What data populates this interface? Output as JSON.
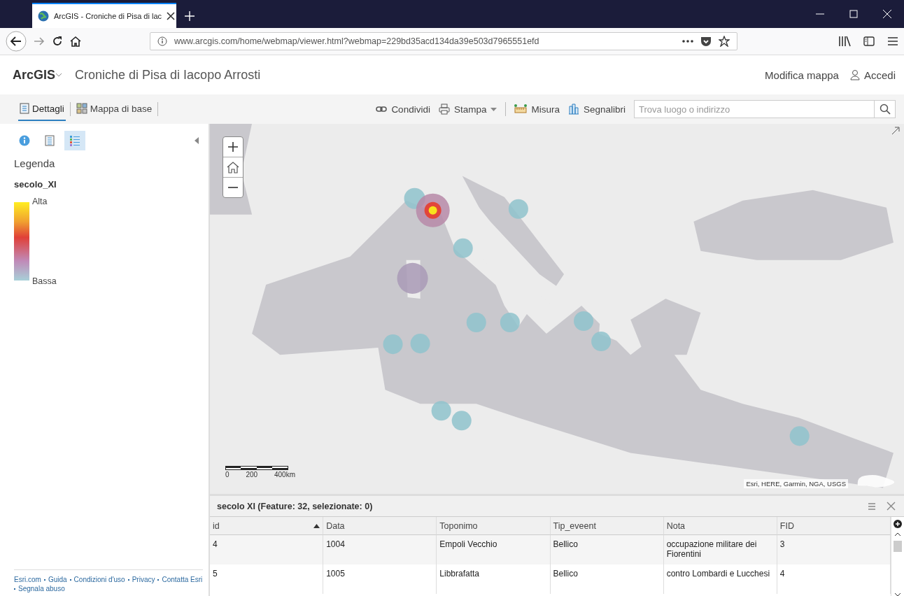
{
  "browser": {
    "tab": {
      "title": "ArcGIS - Croniche di Pisa di lac"
    },
    "url": "www.arcgis.com/home/webmap/viewer.html?webmap=229bd35acd134da39e503d7965551efd"
  },
  "header": {
    "app": "ArcGIS",
    "title": "Croniche di Pisa di Iacopo Arrosti",
    "actions": [
      {
        "label": "Modifica mappa",
        "kind": "text"
      },
      {
        "label": "Accedi",
        "kind": "user"
      }
    ]
  },
  "toolbar": {
    "tabs": [
      {
        "label": "Dettagli",
        "kind": "details",
        "selected": true
      },
      {
        "label": "Mappa di base",
        "kind": "basemap",
        "selected": false
      }
    ],
    "tools": [
      {
        "label": "Condividi",
        "kind": "share",
        "dropdown": false
      },
      {
        "label": "Stampa",
        "kind": "print",
        "dropdown": true
      },
      {
        "label": "Misura",
        "kind": "measure",
        "dropdown": false
      },
      {
        "label": "Segnalibri",
        "kind": "bookmarks",
        "dropdown": false
      }
    ],
    "search": {
      "placeholder": "Trova luogo o indirizzo"
    }
  },
  "sidebar": {
    "tabs": [
      {
        "kind": "info",
        "selected": false
      },
      {
        "kind": "content",
        "selected": false
      },
      {
        "kind": "legend",
        "selected": true
      }
    ],
    "heading": "Legenda",
    "layer": "secolo_XI",
    "ramp": {
      "high": "Alta",
      "low": "Bassa"
    },
    "footer_links": [
      "Esri.com",
      "Guida",
      "Condizioni d'uso",
      "Privacy",
      "Contatta Esri",
      "Segnala abuso"
    ]
  },
  "map": {
    "kind": "picture",
    "scale": [
      "0",
      "200",
      "400km"
    ],
    "attribution": "Esri, HERE, Garmin, NGA, USGS"
  },
  "table": {
    "title": "secolo XI (Feature: 32, selezionate: 0)",
    "columns": [
      {
        "label": "id",
        "sorted": true
      },
      {
        "label": "Data",
        "sorted": false
      },
      {
        "label": "Toponimo",
        "sorted": false
      },
      {
        "label": "Tip_eveent",
        "sorted": false
      },
      {
        "label": "Nota",
        "sorted": false
      },
      {
        "label": "FID",
        "sorted": false
      }
    ],
    "rows": [
      [
        "4",
        "1004",
        "Empoli Vecchio",
        "Bellico",
        "occupazione militare dei Fiorentini",
        "3"
      ],
      [
        "5",
        "1005",
        "Libbrafatta",
        "Bellico",
        "contro Lombardi e Lucchesi",
        "4"
      ]
    ]
  }
}
